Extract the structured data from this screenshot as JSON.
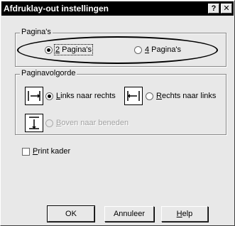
{
  "window": {
    "title": "Afdruklay-out instellingen",
    "help_icon": "question-mark-icon",
    "close_icon": "close-icon"
  },
  "pages_group": {
    "legend": "Pagina's",
    "option_2": {
      "label": "2 Pagina's",
      "selected": true
    },
    "option_4": {
      "label": "4 Pagina's",
      "selected": false
    }
  },
  "order_group": {
    "legend": "Paginavolgorde",
    "left_to_right": {
      "label": "Links naar rechts",
      "selected": true,
      "icon": "left-to-right-arrow-icon"
    },
    "right_to_left": {
      "label": "Rechts naar links",
      "selected": false,
      "icon": "right-to-left-arrow-icon"
    },
    "top_to_bottom": {
      "label": "Boven naar beneden",
      "selected": false,
      "enabled": false,
      "icon": "top-to-bottom-arrow-icon"
    }
  },
  "print_frame": {
    "label": "Print kader",
    "checked": false
  },
  "buttons": {
    "ok": "OK",
    "cancel": "Annuleer",
    "help": "Help"
  }
}
